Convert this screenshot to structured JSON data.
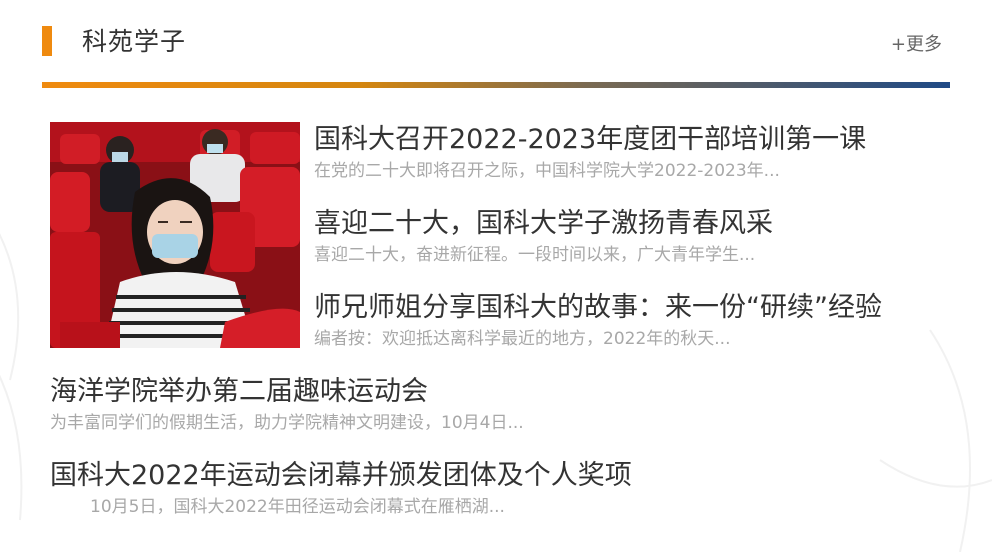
{
  "section": {
    "title": "科苑学子",
    "more_label": "+更多"
  },
  "featured_image": {
    "alt": "photo-students-in-auditorium"
  },
  "news": [
    {
      "title": "国科大召开2022-2023年度团干部培训第一课",
      "desc": "在党的二十大即将召开之际，中国科学院大学2022-2023年..."
    },
    {
      "title": "喜迎二十大，国科大学子激扬青春风采",
      "desc": "喜迎二十大，奋进新征程。一段时间以来，广大青年学生..."
    },
    {
      "title": "师兄师姐分享国科大的故事：来一份“研续”经验",
      "desc": "编者按：欢迎抵达离科学最近的地方，2022年的秋天..."
    },
    {
      "title": "海洋学院举办第二届趣味运动会",
      "desc": "为丰富同学们的假期生活，助力学院精神文明建设，10月4日..."
    },
    {
      "title": "国科大2022年运动会闭幕并颁发团体及个人奖项",
      "desc": "10月5日，国科大2022年田径运动会闭幕式在雁栖湖..."
    }
  ],
  "colors": {
    "accent_orange": "#ef8a0f",
    "accent_blue": "#1f4a86",
    "title_text": "#333333",
    "desc_text": "#a8a8a8"
  }
}
